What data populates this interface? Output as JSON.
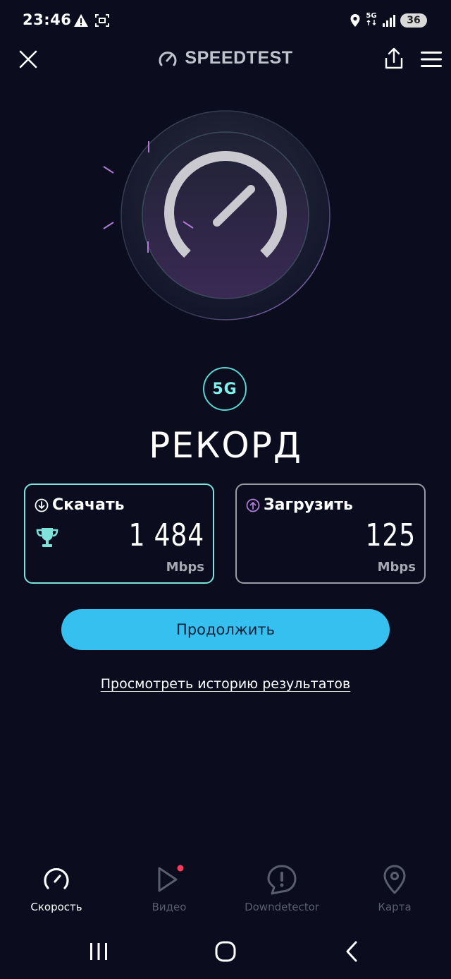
{
  "status_bar": {
    "time": "23:46",
    "network_badge_top": "5G",
    "battery": "36"
  },
  "header": {
    "brand": "SPEEDTEST"
  },
  "network": {
    "type": "5G"
  },
  "result": {
    "title": "РЕКОРД",
    "download": {
      "label": "Скачать",
      "value": "1 484",
      "unit": "Mbps"
    },
    "upload": {
      "label": "Загрузить",
      "value": "125",
      "unit": "Mbps"
    }
  },
  "actions": {
    "continue_label": "Продолжить",
    "history_label": "Просмотреть историю результатов"
  },
  "bottom_nav": {
    "items": [
      {
        "label": "Скорость",
        "icon": "speedometer-icon",
        "active": true
      },
      {
        "label": "Видео",
        "icon": "play-icon",
        "active": false
      },
      {
        "label": "Downdetector",
        "icon": "alert-icon",
        "active": false
      },
      {
        "label": "Карта",
        "icon": "map-pin-icon",
        "active": false
      }
    ]
  },
  "colors": {
    "background": "#0b0d1f",
    "accent_teal": "#7fe3dc",
    "button_blue": "#35c0f0",
    "upload_purple": "#b07ad8",
    "notification_dot": "#ff3b5c"
  }
}
